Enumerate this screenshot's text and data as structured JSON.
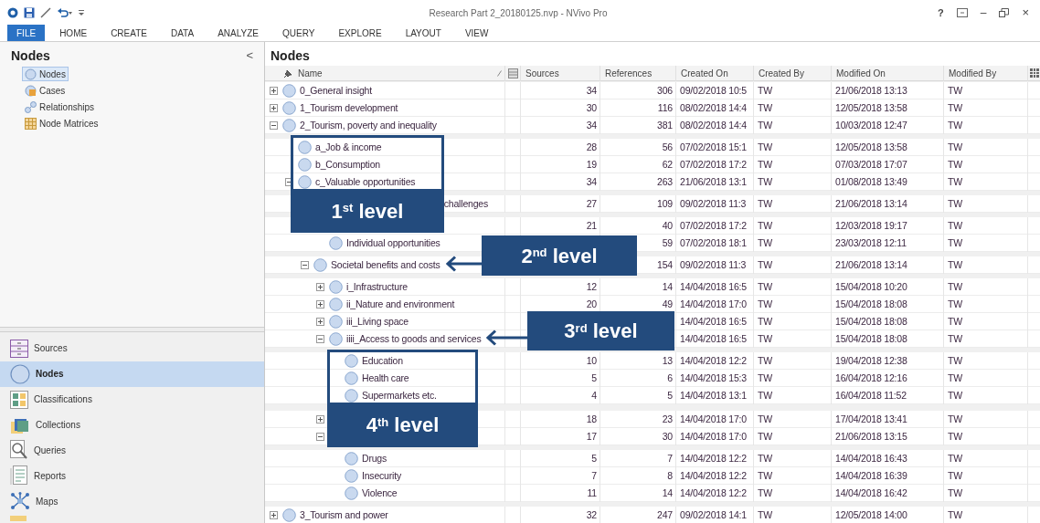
{
  "window": {
    "title": "Research Part 2_20180125.nvp - NVivo Pro",
    "help": "?",
    "minimize": "–",
    "close": "×"
  },
  "ribbon_tabs": [
    {
      "label": "FILE",
      "selected": true
    },
    {
      "label": "HOME",
      "selected": false
    },
    {
      "label": "CREATE",
      "selected": false
    },
    {
      "label": "DATA",
      "selected": false
    },
    {
      "label": "ANALYZE",
      "selected": false
    },
    {
      "label": "QUERY",
      "selected": false
    },
    {
      "label": "EXPLORE",
      "selected": false
    },
    {
      "label": "LAYOUT",
      "selected": false
    },
    {
      "label": "VIEW",
      "selected": false
    }
  ],
  "sidebar": {
    "title": "Nodes",
    "collapse": "<",
    "items": [
      {
        "label": "Nodes",
        "kind": "nodes",
        "selected": true
      },
      {
        "label": "Cases",
        "kind": "cases",
        "selected": false
      },
      {
        "label": "Relationships",
        "kind": "relationships",
        "selected": false
      },
      {
        "label": "Node Matrices",
        "kind": "matrices",
        "selected": false
      }
    ]
  },
  "navigation": [
    {
      "label": "Sources",
      "kind": "sources",
      "selected": false
    },
    {
      "label": "Nodes",
      "kind": "nodes",
      "selected": true
    },
    {
      "label": "Classifications",
      "kind": "classifications",
      "selected": false
    },
    {
      "label": "Collections",
      "kind": "collections",
      "selected": false
    },
    {
      "label": "Queries",
      "kind": "queries",
      "selected": false
    },
    {
      "label": "Reports",
      "kind": "reports",
      "selected": false
    },
    {
      "label": "Maps",
      "kind": "maps",
      "selected": false
    }
  ],
  "list": {
    "title": "Nodes",
    "columns": [
      "Name",
      "Sources",
      "References",
      "Created On",
      "Created By",
      "Modified On",
      "Modified By"
    ],
    "rows": [
      {
        "kind": "node",
        "name": "0_General insight",
        "expanded": false,
        "sources": "34",
        "references": "306",
        "created_on": "09/02/2018 10:5",
        "created_by": "TW",
        "modified_on": "21/06/2018 13:13",
        "modified_by": "TW"
      },
      {
        "kind": "node",
        "name": "1_Tourism development",
        "expanded": false,
        "sources": "30",
        "references": "116",
        "created_on": "08/02/2018 14:4",
        "created_by": "TW",
        "modified_on": "12/05/2018 13:58",
        "modified_by": "TW"
      },
      {
        "kind": "node",
        "name": "2_Tourism, poverty and inequality",
        "expanded": true,
        "sources": "34",
        "references": "381",
        "created_on": "08/02/2018 14:4",
        "created_by": "TW",
        "modified_on": "10/03/2018 12:47",
        "modified_by": "TW",
        "children": [
          {
            "kind": "node",
            "name": "a_Job & income",
            "sources": "28",
            "references": "56",
            "created_on": "07/02/2018 15:1",
            "created_by": "TW",
            "modified_on": "12/05/2018 13:58",
            "modified_by": "TW"
          },
          {
            "kind": "node",
            "name": "b_Consumption",
            "sources": "19",
            "references": "62",
            "created_on": "07/02/2018 17:2",
            "created_by": "TW",
            "modified_on": "07/03/2018 17:07",
            "modified_by": "TW"
          },
          {
            "kind": "node",
            "name": "c_Valuable opportunities",
            "expanded": true,
            "sources": "34",
            "references": "263",
            "created_on": "21/06/2018 13:1",
            "created_by": "TW",
            "modified_on": "01/08/2018 13:49",
            "modified_by": "TW",
            "children": [
              {
                "kind": "clipped",
                "name": "challenges",
                "sources": "27",
                "references": "109",
                "created_on": "09/02/2018 11:3",
                "created_by": "TW",
                "modified_on": "21/06/2018 13:14",
                "modified_by": "TW"
              },
              {
                "kind": "covered",
                "sources": "21",
                "references": "40",
                "created_on": "07/02/2018 17:2",
                "created_by": "TW",
                "modified_on": "12/03/2018 19:17",
                "modified_by": "TW",
                "children": [
                  {
                    "kind": "node",
                    "name": "Individual opportunities",
                    "references": "59",
                    "created_on": "07/02/2018 18:1",
                    "created_by": "TW",
                    "modified_on": "23/03/2018 12:11",
                    "modified_by": "TW"
                  }
                ]
              },
              {
                "kind": "node",
                "name": "Societal benefits and costs",
                "expanded": true,
                "references": "154",
                "created_on": "09/02/2018 11:3",
                "created_by": "TW",
                "modified_on": "21/06/2018 13:14",
                "modified_by": "TW",
                "children": [
                  {
                    "kind": "node",
                    "name": "i_Infrastructure",
                    "expanded": false,
                    "sources": "12",
                    "references": "14",
                    "created_on": "14/04/2018 16:5",
                    "created_by": "TW",
                    "modified_on": "15/04/2018 10:20",
                    "modified_by": "TW"
                  },
                  {
                    "kind": "node",
                    "name": "ii_Nature and environment",
                    "expanded": false,
                    "sources": "20",
                    "references": "49",
                    "created_on": "14/04/2018 17:0",
                    "created_by": "TW",
                    "modified_on": "15/04/2018 18:08",
                    "modified_by": "TW"
                  },
                  {
                    "kind": "node",
                    "name": "iii_Living space",
                    "expanded": false,
                    "created_on": "14/04/2018 16:5",
                    "created_by": "TW",
                    "modified_on": "15/04/2018 18:08",
                    "modified_by": "TW"
                  },
                  {
                    "kind": "node",
                    "name": "iiii_Access to goods and services",
                    "expanded": true,
                    "created_on": "14/04/2018 16:5",
                    "created_by": "TW",
                    "modified_on": "15/04/2018 18:08",
                    "modified_by": "TW",
                    "children": [
                      {
                        "kind": "node",
                        "name": "Education",
                        "sources": "10",
                        "references": "13",
                        "created_on": "14/04/2018 12:2",
                        "created_by": "TW",
                        "modified_on": "19/04/2018 12:38",
                        "modified_by": "TW"
                      },
                      {
                        "kind": "node",
                        "name": "Health care",
                        "sources": "5",
                        "references": "6",
                        "created_on": "14/04/2018 15:3",
                        "created_by": "TW",
                        "modified_on": "16/04/2018 12:16",
                        "modified_by": "TW"
                      },
                      {
                        "kind": "node",
                        "name": "Supermarkets etc.",
                        "sources": "4",
                        "references": "5",
                        "created_on": "14/04/2018 13:1",
                        "created_by": "TW",
                        "modified_on": "16/04/2018 11:52",
                        "modified_by": "TW"
                      }
                    ]
                  },
                  {
                    "kind": "covered",
                    "expanded": false,
                    "sources": "18",
                    "references": "23",
                    "created_on": "14/04/2018 17:0",
                    "created_by": "TW",
                    "modified_on": "17/04/2018 13:41",
                    "modified_by": "TW"
                  },
                  {
                    "kind": "covered",
                    "expanded": true,
                    "sources": "17",
                    "references": "30",
                    "created_on": "14/04/2018 17:0",
                    "created_by": "TW",
                    "modified_on": "21/06/2018 13:15",
                    "modified_by": "TW",
                    "children": [
                      {
                        "kind": "node",
                        "name": "Drugs",
                        "sources": "5",
                        "references": "7",
                        "created_on": "14/04/2018 12:2",
                        "created_by": "TW",
                        "modified_on": "14/04/2018 16:43",
                        "modified_by": "TW"
                      },
                      {
                        "kind": "node",
                        "name": "Insecurity",
                        "sources": "7",
                        "references": "8",
                        "created_on": "14/04/2018 12:2",
                        "created_by": "TW",
                        "modified_on": "14/04/2018 16:39",
                        "modified_by": "TW"
                      },
                      {
                        "kind": "node",
                        "name": "Violence",
                        "sources": "11",
                        "references": "14",
                        "created_on": "14/04/2018 12:2",
                        "created_by": "TW",
                        "modified_on": "14/04/2018 16:42",
                        "modified_by": "TW"
                      }
                    ]
                  }
                ]
              }
            ]
          }
        ]
      },
      {
        "kind": "node",
        "name": "3_Tourism and power",
        "expanded": false,
        "sources": "32",
        "references": "247",
        "created_on": "09/02/2018 14:1",
        "created_by": "TW",
        "modified_on": "12/05/2018 14:00",
        "modified_by": "TW"
      }
    ]
  },
  "callouts": [
    {
      "text": "1$^{st}$ level",
      "outline": true,
      "arrow": false
    },
    {
      "text": "2$^{nd}$ level",
      "outline": false,
      "arrow": true
    },
    {
      "text": "3$^{rd}$ level",
      "outline": false,
      "arrow": true
    },
    {
      "text": "4$^{th}$ level",
      "outline": true,
      "arrow": false
    }
  ]
}
